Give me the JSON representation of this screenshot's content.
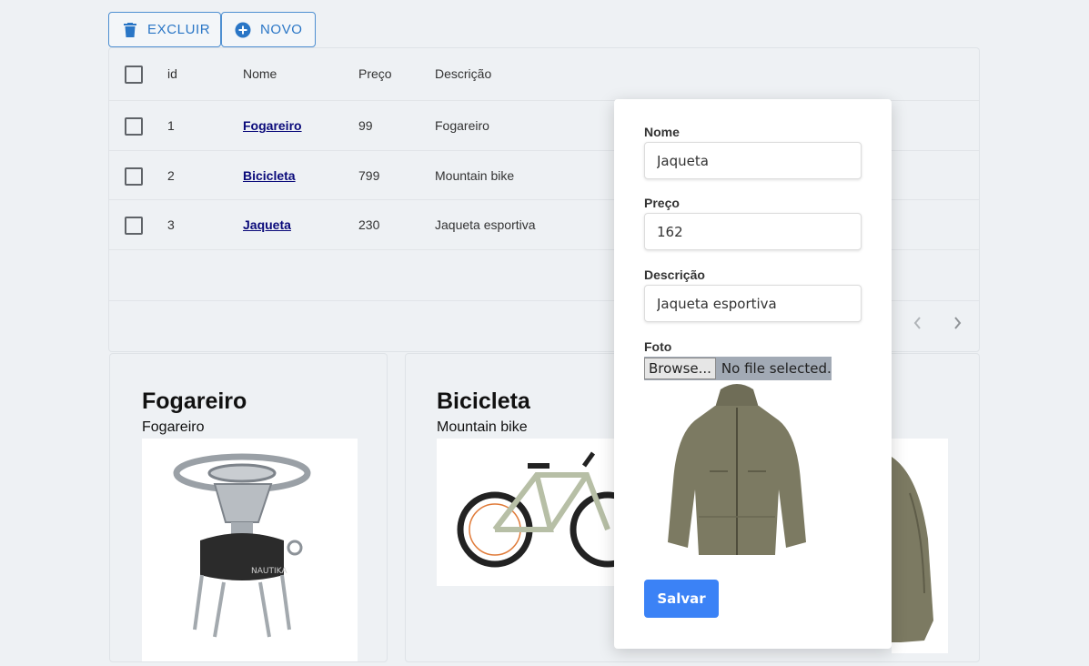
{
  "toolbar": {
    "delete_label": "EXCLUIR",
    "new_label": "NOVO"
  },
  "table": {
    "columns": [
      "id",
      "Nome",
      "Preço",
      "Descrição"
    ],
    "rows": [
      {
        "id": "1",
        "nome": "Fogareiro",
        "preco": "99",
        "descricao": "Fogareiro"
      },
      {
        "id": "2",
        "nome": "Bicicleta",
        "preco": "799",
        "descricao": "Mountain bike"
      },
      {
        "id": "3",
        "nome": "Jaqueta",
        "preco": "230",
        "descricao": "Jaqueta esportiva"
      }
    ]
  },
  "cards": [
    {
      "title": "Fogareiro",
      "description": "Fogareiro"
    },
    {
      "title": "Bicicleta",
      "description": "Mountain bike"
    }
  ],
  "form": {
    "nome_label": "Nome",
    "nome_value": "Jaqueta",
    "preco_label": "Preço",
    "preco_value": "162",
    "descricao_label": "Descrição",
    "descricao_value": "Jaqueta esportiva",
    "foto_label": "Foto",
    "browse_label": "Browse...",
    "file_status": "No file selected.",
    "save_label": "Salvar"
  },
  "icons": {
    "delete": "trash-icon",
    "new": "plus-circle-icon",
    "prev": "chevron-left-icon",
    "next": "chevron-right-icon"
  },
  "colors": {
    "accent": "#3b82f6",
    "outline_button": "#2a76c6",
    "link": "#0a0a7a"
  }
}
